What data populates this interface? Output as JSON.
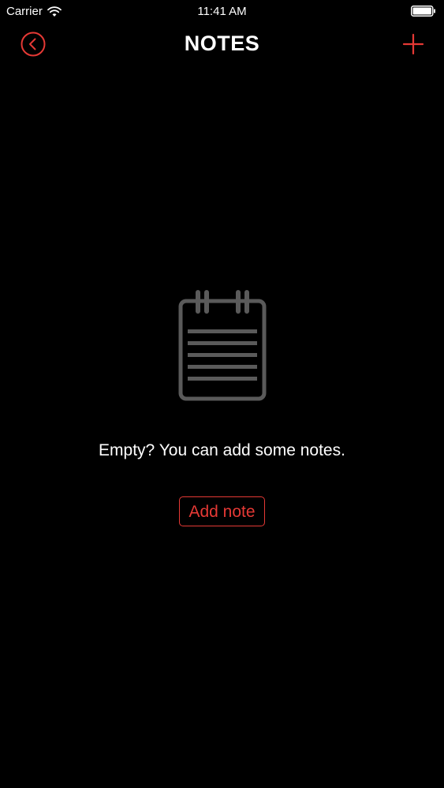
{
  "status_bar": {
    "carrier": "Carrier",
    "time": "11:41 AM",
    "wifi_icon": "wifi-icon",
    "battery_icon": "battery-full-icon"
  },
  "nav": {
    "title": "NOTES",
    "back_icon": "back-circle-icon",
    "add_icon": "plus-icon"
  },
  "empty_state": {
    "icon": "notepad-icon",
    "message": "Empty? You can add some notes.",
    "button_label": "Add note"
  },
  "colors": {
    "background": "#000000",
    "accent": "#e53935",
    "text": "#ffffff",
    "icon_gray": "#5a5a5a"
  }
}
